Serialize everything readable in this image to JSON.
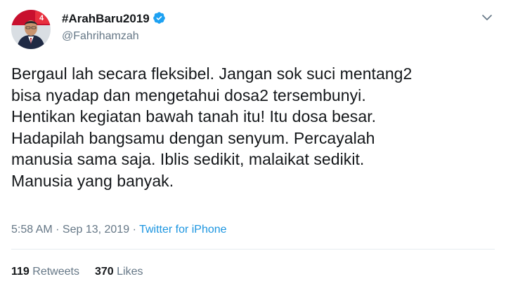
{
  "author": {
    "display_name": "#ArahBaru2019",
    "handle": "@Fahrihamzah",
    "verified": true,
    "avatar_icon": "profile-photo-icon"
  },
  "tweet": {
    "lines": [
      "Bergaul lah secara fleksibel. Jangan sok suci mentang2",
      "bisa nyadap dan mengetahui dosa2 tersembunyi.",
      "Hentikan kegiatan bawah tanah itu! Itu dosa besar.",
      "Hadapilah bangsamu dengan senyum. Percayalah",
      "manusia sama saja. Iblis sedikit, malaikat sedikit.",
      "Manusia yang banyak."
    ]
  },
  "meta": {
    "time": "5:58 AM",
    "separator": " · ",
    "date": "Sep 13, 2019",
    "source": "Twitter for iPhone"
  },
  "stats": {
    "retweets_count": "119",
    "retweets_label": "Retweets",
    "likes_count": "370",
    "likes_label": "Likes"
  },
  "colors": {
    "text": "#14171a",
    "secondary": "#657786",
    "link": "#1b95e0",
    "verified": "#1da1f2",
    "divider": "#e6ecf0"
  }
}
